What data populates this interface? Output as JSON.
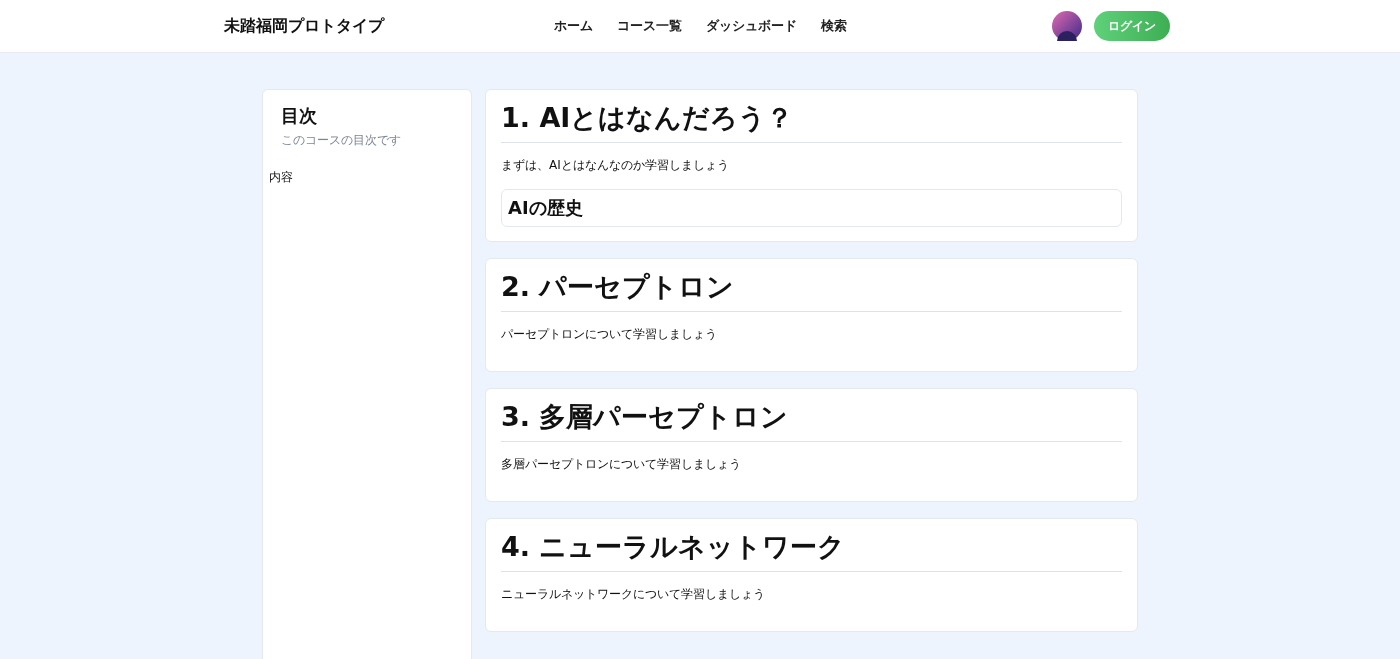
{
  "header": {
    "brand": "未踏福岡プロトタイプ",
    "nav": [
      {
        "label": "ホーム"
      },
      {
        "label": "コース一覧"
      },
      {
        "label": "ダッシュボード"
      },
      {
        "label": "検索"
      }
    ],
    "login": "ログイン"
  },
  "sidebar": {
    "title": "目次",
    "subtitle": "このコースの目次です",
    "items": [
      {
        "label": "内容"
      }
    ]
  },
  "sections": [
    {
      "title": "1. AIとはなんだろう？",
      "description": "まずは、AIとはなんなのか学習しましょう",
      "subsections": [
        {
          "title": "AIの歴史"
        }
      ]
    },
    {
      "title": "2. パーセプトロン",
      "description": "パーセプトロンについて学習しましょう"
    },
    {
      "title": "3. 多層パーセプトロン",
      "description": "多層パーセプトロンについて学習しましょう"
    },
    {
      "title": "4. ニューラルネットワーク",
      "description": "ニューラルネットワークについて学習しましょう"
    }
  ]
}
